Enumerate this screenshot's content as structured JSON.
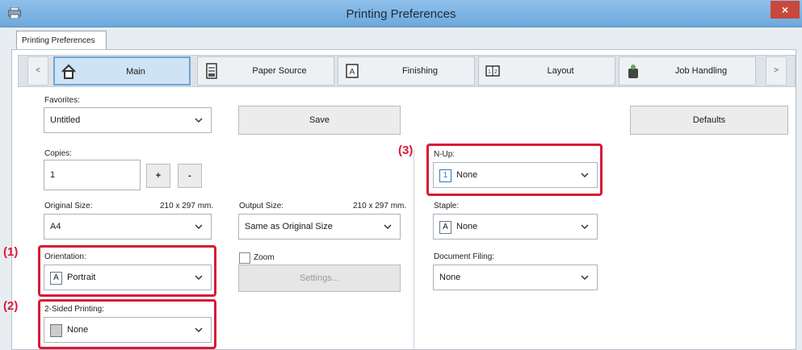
{
  "window": {
    "title": "Printing Preferences",
    "close_glyph": "×"
  },
  "outer_tab": "Printing Preferences",
  "nav": {
    "prev": "<",
    "next": ">"
  },
  "tabs": [
    {
      "label": "Main",
      "icon": "home-icon"
    },
    {
      "label": "Paper Source",
      "icon": "paper-tray-icon"
    },
    {
      "label": "Finishing",
      "icon": "finishing-icon"
    },
    {
      "label": "Layout",
      "icon": "layout-icon"
    },
    {
      "label": "Job Handling",
      "icon": "job-handling-icon"
    }
  ],
  "favorites": {
    "label": "Favorites:",
    "value": "Untitled"
  },
  "buttons": {
    "save": "Save",
    "defaults": "Defaults",
    "plus": "+",
    "minus": "-",
    "settings": "Settings..."
  },
  "copies": {
    "label": "Copies:",
    "value": "1"
  },
  "original_size": {
    "label": "Original Size:",
    "dims": "210 x 297 mm.",
    "value": "A4"
  },
  "output_size": {
    "label": "Output Size:",
    "dims": "210 x 297 mm.",
    "value": "Same as Original Size"
  },
  "orientation": {
    "label": "Orientation:",
    "value": "Portrait",
    "icon_glyph": "A"
  },
  "zoom": {
    "label": "Zoom"
  },
  "two_sided": {
    "label": "2-Sided Printing:",
    "value": "None"
  },
  "n_up": {
    "label": "N-Up:",
    "value": "None",
    "icon_glyph": "1"
  },
  "staple": {
    "label": "Staple:",
    "value": "None",
    "icon_glyph": "A"
  },
  "document_filing": {
    "label": "Document Filing:",
    "value": "None"
  },
  "callouts": {
    "c1": "(1)",
    "c2": "(2)",
    "c3": "(3)"
  },
  "colors": {
    "highlight": "#d81a36",
    "active_tab": "#cfe3f6",
    "titlebar": "#7fb4e4"
  }
}
